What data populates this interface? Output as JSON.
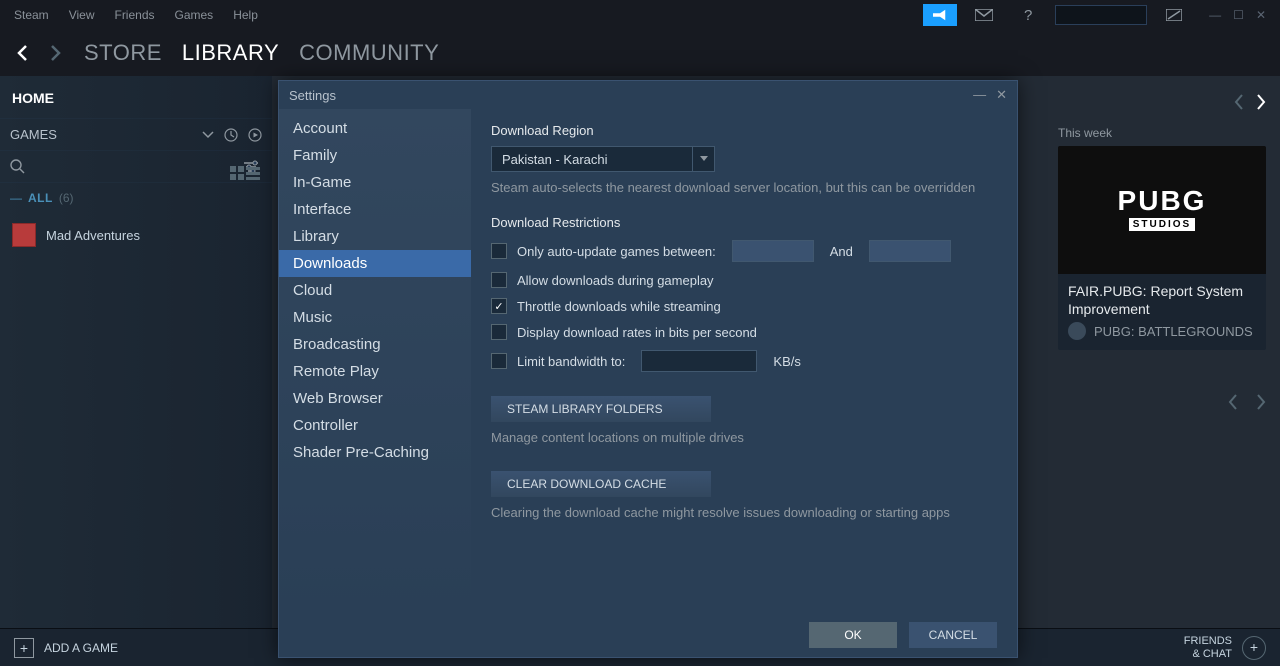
{
  "menubar": {
    "items": [
      "Steam",
      "View",
      "Friends",
      "Games",
      "Help"
    ],
    "help_symbol": "?"
  },
  "nav": {
    "items": [
      "STORE",
      "LIBRARY",
      "COMMUNITY"
    ],
    "active": "LIBRARY"
  },
  "sidebar": {
    "home": "HOME",
    "games_header": "GAMES",
    "category": {
      "name": "ALL",
      "count": "(6)"
    },
    "add_game": "ADD A GAME",
    "games": [
      {
        "name": "Mad Adventures"
      }
    ]
  },
  "news": {
    "week_label": "This week",
    "logo_big": "PUBG",
    "logo_small": "STUDIOS",
    "title": "FAIR.PUBG: Report System Improvement",
    "source": "PUBG: BATTLEGROUNDS"
  },
  "friends_chat": {
    "line1": "FRIENDS",
    "line2": "& CHAT"
  },
  "dialog": {
    "title": "Settings",
    "nav": [
      "Account",
      "Family",
      "In-Game",
      "Interface",
      "Library",
      "Downloads",
      "Cloud",
      "Music",
      "Broadcasting",
      "Remote Play",
      "Web Browser",
      "Controller",
      "Shader Pre-Caching"
    ],
    "active": "Downloads",
    "download_region": {
      "title": "Download Region",
      "value": "Pakistan - Karachi",
      "help": "Steam auto-selects the nearest download server location, but this can be overridden"
    },
    "restrictions": {
      "title": "Download Restrictions",
      "auto_update": {
        "label": "Only auto-update games between:",
        "and": "And",
        "checked": false
      },
      "allow_gameplay": {
        "label": "Allow downloads during gameplay",
        "checked": false
      },
      "throttle_stream": {
        "label": "Throttle downloads while streaming",
        "checked": true
      },
      "bits_rate": {
        "label": "Display download rates in bits per second",
        "checked": false
      },
      "limit_bw": {
        "label": "Limit bandwidth to:",
        "unit": "KB/s",
        "checked": false
      }
    },
    "library_folders": {
      "button": "STEAM LIBRARY FOLDERS",
      "help": "Manage content locations on multiple drives"
    },
    "clear_cache": {
      "button": "CLEAR DOWNLOAD CACHE",
      "help": "Clearing the download cache might resolve issues downloading or starting apps"
    },
    "footer": {
      "ok": "OK",
      "cancel": "CANCEL"
    }
  }
}
